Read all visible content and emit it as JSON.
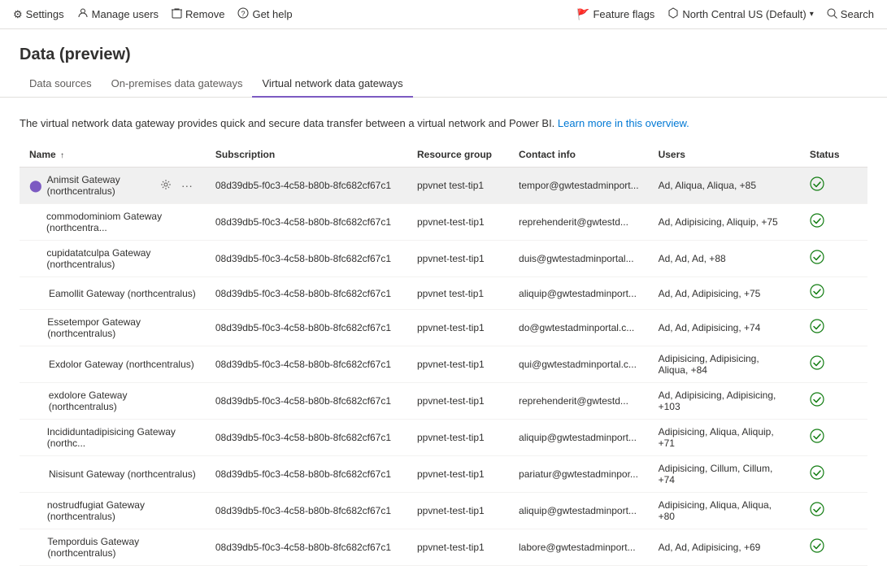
{
  "topNav": {
    "left": [
      {
        "id": "settings",
        "icon": "⚙",
        "label": "Settings"
      },
      {
        "id": "manage-users",
        "icon": "👤",
        "label": "Manage users"
      },
      {
        "id": "remove",
        "icon": "🗑",
        "label": "Remove"
      },
      {
        "id": "get-help",
        "icon": "ℹ",
        "label": "Get help"
      }
    ],
    "right": [
      {
        "id": "feature-flags",
        "icon": "🚩",
        "label": "Feature flags"
      },
      {
        "id": "region",
        "icon": "🌐",
        "label": "North Central US (Default)"
      },
      {
        "id": "search",
        "icon": "🔍",
        "label": "Search"
      }
    ]
  },
  "page": {
    "title": "Data (preview)"
  },
  "tabs": [
    {
      "id": "data-sources",
      "label": "Data sources",
      "active": false
    },
    {
      "id": "on-premises",
      "label": "On-premises data gateways",
      "active": false
    },
    {
      "id": "vnet",
      "label": "Virtual network data gateways",
      "active": true
    }
  ],
  "description": {
    "text": "The virtual network data gateway provides quick and secure data transfer between a virtual network and Power BI.",
    "linkText": "Learn more in this overview.",
    "linkHref": "#"
  },
  "table": {
    "columns": [
      {
        "id": "name",
        "label": "Name",
        "sortable": true,
        "sortDir": "asc"
      },
      {
        "id": "subscription",
        "label": "Subscription"
      },
      {
        "id": "resource-group",
        "label": "Resource group"
      },
      {
        "id": "contact-info",
        "label": "Contact info"
      },
      {
        "id": "users",
        "label": "Users"
      },
      {
        "id": "status",
        "label": "Status"
      }
    ],
    "rows": [
      {
        "id": 1,
        "selected": true,
        "name": "Animsit Gateway (northcentralus)",
        "subscription": "08d39db5-f0c3-4c58-b80b-8fc682cf67c1",
        "resourceGroup": "ppvnet test-tip1",
        "contactInfo": "tempor@gwtestadminport...",
        "users": "Ad, Aliqua, Aliqua, +85",
        "status": "ok"
      },
      {
        "id": 2,
        "selected": false,
        "name": "commodominiom Gateway (northcentra...",
        "subscription": "08d39db5-f0c3-4c58-b80b-8fc682cf67c1",
        "resourceGroup": "ppvnet-test-tip1",
        "contactInfo": "reprehenderit@gwtestd...",
        "users": "Ad, Adipisicing, Aliquip, +75",
        "status": "ok"
      },
      {
        "id": 3,
        "selected": false,
        "name": "cupidatatculpa Gateway (northcentralus)",
        "subscription": "08d39db5-f0c3-4c58-b80b-8fc682cf67c1",
        "resourceGroup": "ppvnet-test-tip1",
        "contactInfo": "duis@gwtestadminportal...",
        "users": "Ad, Ad, Ad, +88",
        "status": "ok"
      },
      {
        "id": 4,
        "selected": false,
        "name": "Eamollit Gateway (northcentralus)",
        "subscription": "08d39db5-f0c3-4c58-b80b-8fc682cf67c1",
        "resourceGroup": "ppvnet test-tip1",
        "contactInfo": "aliquip@gwtestadminport...",
        "users": "Ad, Ad, Adipisicing, +75",
        "status": "ok"
      },
      {
        "id": 5,
        "selected": false,
        "name": "Essetempor Gateway (northcentralus)",
        "subscription": "08d39db5-f0c3-4c58-b80b-8fc682cf67c1",
        "resourceGroup": "ppvnet-test-tip1",
        "contactInfo": "do@gwtestadminportal.c...",
        "users": "Ad, Ad, Adipisicing, +74",
        "status": "ok"
      },
      {
        "id": 6,
        "selected": false,
        "name": "Exdolor Gateway (northcentralus)",
        "subscription": "08d39db5-f0c3-4c58-b80b-8fc682cf67c1",
        "resourceGroup": "ppvnet-test-tip1",
        "contactInfo": "qui@gwtestadminportal.c...",
        "users": "Adipisicing, Adipisicing, Aliqua, +84",
        "status": "ok"
      },
      {
        "id": 7,
        "selected": false,
        "name": "exdolore Gateway (northcentralus)",
        "subscription": "08d39db5-f0c3-4c58-b80b-8fc682cf67c1",
        "resourceGroup": "ppvnet-test-tip1",
        "contactInfo": "reprehenderit@gwtestd...",
        "users": "Ad, Adipisicing, Adipisicing, +103",
        "status": "ok"
      },
      {
        "id": 8,
        "selected": false,
        "name": "Incididuntadipisicing Gateway (northc...",
        "subscription": "08d39db5-f0c3-4c58-b80b-8fc682cf67c1",
        "resourceGroup": "ppvnet-test-tip1",
        "contactInfo": "aliquip@gwtestadminport...",
        "users": "Adipisicing, Aliqua, Aliquip, +71",
        "status": "ok"
      },
      {
        "id": 9,
        "selected": false,
        "name": "Nisisunt Gateway (northcentralus)",
        "subscription": "08d39db5-f0c3-4c58-b80b-8fc682cf67c1",
        "resourceGroup": "ppvnet-test-tip1",
        "contactInfo": "pariatur@gwtestadminpor...",
        "users": "Adipisicing, Cillum, Cillum, +74",
        "status": "ok"
      },
      {
        "id": 10,
        "selected": false,
        "name": "nostrudfugiat Gateway (northcentralus)",
        "subscription": "08d39db5-f0c3-4c58-b80b-8fc682cf67c1",
        "resourceGroup": "ppvnet-test-tip1",
        "contactInfo": "aliquip@gwtestadminport...",
        "users": "Adipisicing, Aliqua, Aliqua, +80",
        "status": "ok"
      },
      {
        "id": 11,
        "selected": false,
        "name": "Temporduis Gateway (northcentralus)",
        "subscription": "08d39db5-f0c3-4c58-b80b-8fc682cf67c1",
        "resourceGroup": "ppvnet-test-tip1",
        "contactInfo": "labore@gwtestadminport...",
        "users": "Ad, Ad, Adipisicing, +69",
        "status": "ok"
      }
    ]
  }
}
